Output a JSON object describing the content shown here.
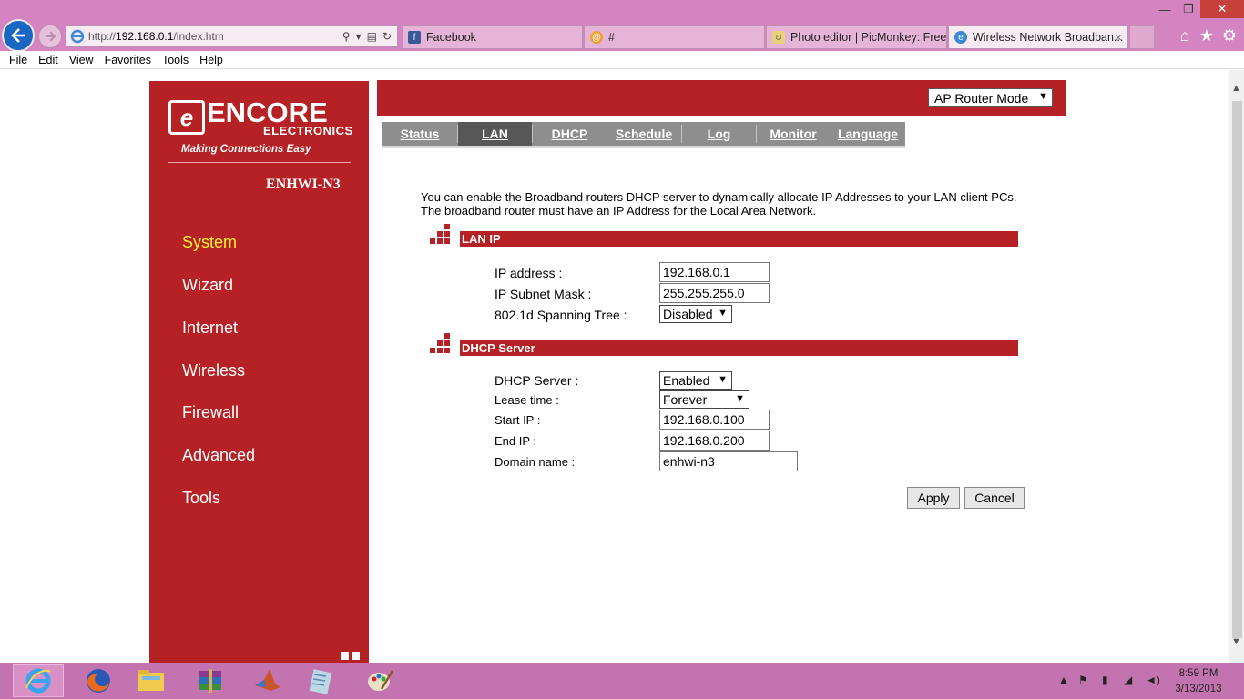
{
  "browser": {
    "address_url_prefix": "http://",
    "address_url_host": "192.168.0.1",
    "address_url_path": "/index.htm",
    "tabs": [
      {
        "label": "Facebook"
      },
      {
        "label": "#"
      },
      {
        "label": "Photo editor | PicMonkey: Free..."
      },
      {
        "label": "Wireless Network Broadban..."
      }
    ],
    "close_glyph": "×",
    "menu": [
      "File",
      "Edit",
      "View",
      "Favorites",
      "Tools",
      "Help"
    ]
  },
  "router": {
    "logo": {
      "word": "ENCORE",
      "sub": "ELECTRONICS",
      "tagline": "Making Connections Easy",
      "mark": "e"
    },
    "model": "ENHWI-N3",
    "mode_select": "AP Router Mode",
    "side_nav": [
      "System",
      "Wizard",
      "Internet",
      "Wireless",
      "Firewall",
      "Advanced",
      "Tools"
    ],
    "selected_side": "System",
    "tabs": [
      "Status",
      "LAN",
      "DHCP",
      "Schedule",
      "Log",
      "Monitor",
      "Language"
    ],
    "active_tab": "LAN",
    "description": "You can enable the Broadband routers DHCP server to dynamically allocate IP Addresses to your LAN client PCs. The broadband router must have an IP Address for the Local Area Network.",
    "lan_section": {
      "title": "LAN IP",
      "ip_label": "IP address :",
      "ip_value": "192.168.0.1",
      "mask_label": "IP Subnet Mask :",
      "mask_value": "255.255.255.0",
      "stp_label": "802.1d Spanning Tree :",
      "stp_value": "Disabled"
    },
    "dhcp_section": {
      "title": "DHCP Server",
      "server_label": "DHCP Server :",
      "server_value": "Enabled",
      "lease_label": "Lease time :",
      "lease_value": "Forever",
      "start_label": "Start IP :",
      "start_value": "192.168.0.100",
      "end_label": "End IP :",
      "end_value": "192.168.0.200",
      "domain_label": "Domain name :",
      "domain_value": "enhwi-n3"
    },
    "apply_label": "Apply",
    "cancel_label": "Cancel"
  },
  "taskbar": {
    "time": "8:59 PM",
    "date": "3/13/2013"
  },
  "colors": {
    "brand_red": "#b52124",
    "chrome_pink": "#d484c0",
    "taskbar": "#c373b0",
    "tab_gray": "#8e8e8e",
    "tab_active": "#575757",
    "selected_nav": "#fff033"
  }
}
